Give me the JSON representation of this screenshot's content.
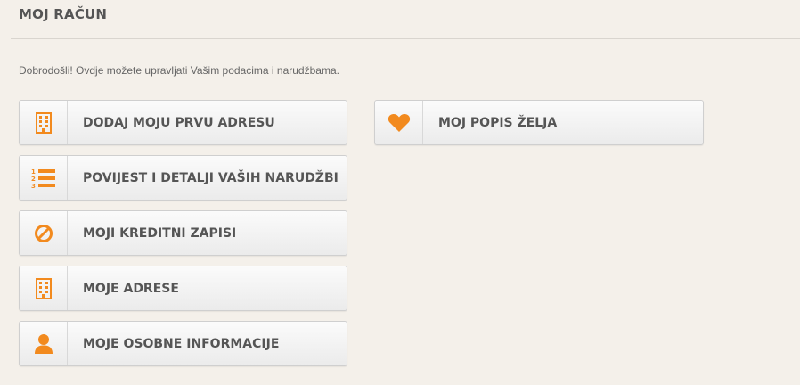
{
  "page": {
    "title": "MOJ RAČUN",
    "intro": "Dobrodošli! Ovdje možete upravljati Vašim podacima i narudžbama."
  },
  "account_links": {
    "left": [
      {
        "label": "DODAJ MOJU PRVU ADRESU",
        "icon": "building-icon"
      },
      {
        "label": "POVIJEST I DETALJI VAŠIH NARUDŽBI",
        "icon": "numbered-list-icon"
      },
      {
        "label": "MOJI KREDITNI ZAPISI",
        "icon": "ban-icon"
      },
      {
        "label": "MOJE ADRESE",
        "icon": "building-icon"
      },
      {
        "label": "MOJE OSOBNE INFORMACIJE",
        "icon": "user-icon"
      }
    ],
    "right": [
      {
        "label": "MOJ POPIS ŽELJA",
        "icon": "heart-icon"
      }
    ]
  },
  "colors": {
    "accent": "#f28a1e",
    "background": "#f4f0ea"
  }
}
